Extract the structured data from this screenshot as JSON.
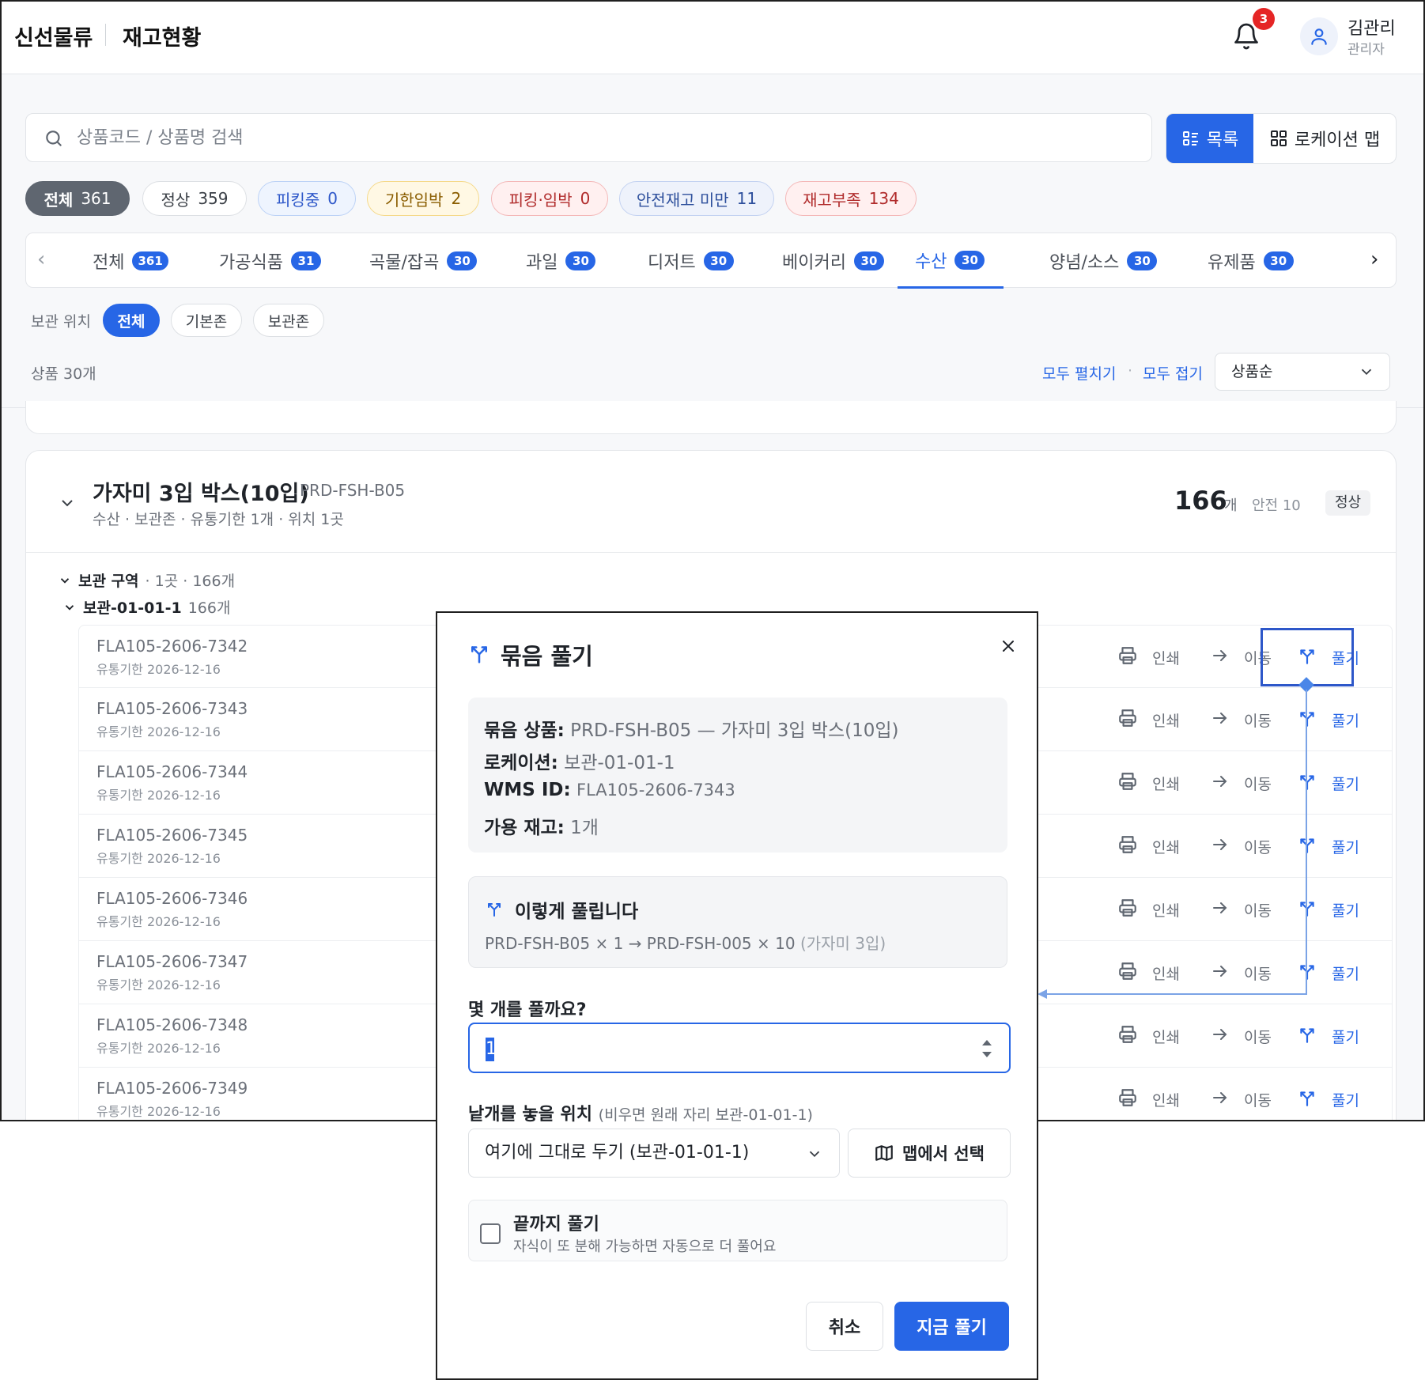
{
  "header": {
    "brand": "신선물류",
    "page_title": "재고현황",
    "notification_count": "3",
    "user_name": "김관리",
    "user_role": "관리자"
  },
  "search": {
    "placeholder": "상품코드 / 상품명 검색",
    "value": ""
  },
  "view_toggle": {
    "list_label": "목록",
    "map_label": "로케이션 맵",
    "active": "list"
  },
  "status_filters": [
    {
      "label": "전체",
      "count": "361",
      "bg": "#5f6670",
      "fg": "#ffffff",
      "border": "#5f6670"
    },
    {
      "label": "정상",
      "count": "359",
      "bg": "#ffffff",
      "fg": "#3a3f46",
      "border": "#dde0e4"
    },
    {
      "label": "피킹중",
      "count": "0",
      "bg": "#eef4fe",
      "fg": "#2d57c9",
      "border": "#bcd2f6"
    },
    {
      "label": "기한임박",
      "count": "2",
      "bg": "#fff8e4",
      "fg": "#8a5d00",
      "border": "#f5d98a"
    },
    {
      "label": "피킹·임박",
      "count": "0",
      "bg": "#fff0f0",
      "fg": "#b02a2a",
      "border": "#f4b8b8"
    },
    {
      "label": "안전재고 미만",
      "count": "11",
      "bg": "#eef2fb",
      "fg": "#2d4f9c",
      "border": "#c3d2f1"
    },
    {
      "label": "재고부족",
      "count": "134",
      "bg": "#fff0f0",
      "fg": "#b02a2a",
      "border": "#f4b8b8"
    }
  ],
  "categories": [
    {
      "label": "전체",
      "count": "361"
    },
    {
      "label": "가공식품",
      "count": "31"
    },
    {
      "label": "곡물/잡곡",
      "count": "30"
    },
    {
      "label": "과일",
      "count": "30"
    },
    {
      "label": "디저트",
      "count": "30"
    },
    {
      "label": "베이커리",
      "count": "30"
    },
    {
      "label": "수산",
      "count": "30",
      "active": true
    },
    {
      "label": "양념/소스",
      "count": "30"
    },
    {
      "label": "유제품",
      "count": "30"
    }
  ],
  "storage": {
    "label": "보관 위치",
    "options": [
      "전체",
      "기본존",
      "보관존"
    ],
    "selected": "전체"
  },
  "list_controls": {
    "count_label": "상품 30개",
    "expand_all": "모두 펼치기",
    "collapse_all": "모두 접기",
    "sort_value": "상품순"
  },
  "product": {
    "name": "가자미 3입 박스(10입)",
    "code": "PRD-FSH-B05",
    "meta": "수산 · 보관존 · 유통기한 1개 · 위치 1곳",
    "qty": "166",
    "qty_unit": "개",
    "safety": "안전 10",
    "status": "정상",
    "zone_title": "보관 구역",
    "zone_meta": "· 1곳 · 166개",
    "location_title": "보관-01-01-1",
    "location_meta": "166개"
  },
  "row_actions": {
    "print": "인쇄",
    "move": "이동",
    "split": "풀기"
  },
  "items": [
    {
      "code": "FLA105-2606-7342",
      "expiry": "유통기한 2026-12-16"
    },
    {
      "code": "FLA105-2606-7343",
      "expiry": "유통기한 2026-12-16"
    },
    {
      "code": "FLA105-2606-7344",
      "expiry": "유통기한 2026-12-16"
    },
    {
      "code": "FLA105-2606-7345",
      "expiry": "유통기한 2026-12-16"
    },
    {
      "code": "FLA105-2606-7346",
      "expiry": "유통기한 2026-12-16"
    },
    {
      "code": "FLA105-2606-7347",
      "expiry": "유통기한 2026-12-16"
    },
    {
      "code": "FLA105-2606-7348",
      "expiry": "유통기한 2026-12-16"
    },
    {
      "code": "FLA105-2606-7349",
      "expiry": "유통기한 2026-12-16"
    }
  ],
  "modal": {
    "title": "묶음 풀기",
    "bundle_key": "묶음 상품:",
    "bundle_val": "PRD-FSH-B05 — 가자미 3입 박스(10입)",
    "location_key": "로케이션:",
    "location_val": "보관-01-01-1",
    "wms_key": "WMS ID:",
    "wms_val": "FLA105-2606-7343",
    "stock_key": "가용 재고:",
    "stock_val": "1개",
    "preview_title": "이렇게 풀립니다",
    "preview_text": "PRD-FSH-B05 × 1 → PRD-FSH-005 × 10",
    "preview_note": "(가자미 3입)",
    "qty_label": "몇 개를 풀까요?",
    "qty_value": "1",
    "place_label": "낱개를 놓을 위치",
    "place_hint": "(비우면 원래 자리 보관-01-01-1)",
    "place_value": "여기에 그대로 두기 (보관-01-01-1)",
    "map_button": "맵에서 선택",
    "recursive_title": "끝까지 풀기",
    "recursive_desc": "자식이 또 분해 가능하면 자동으로 더 풀어요",
    "cancel": "취소",
    "confirm": "지금 풀기"
  },
  "colors": {
    "accent": "#2766e6",
    "danger": "#e52525"
  }
}
